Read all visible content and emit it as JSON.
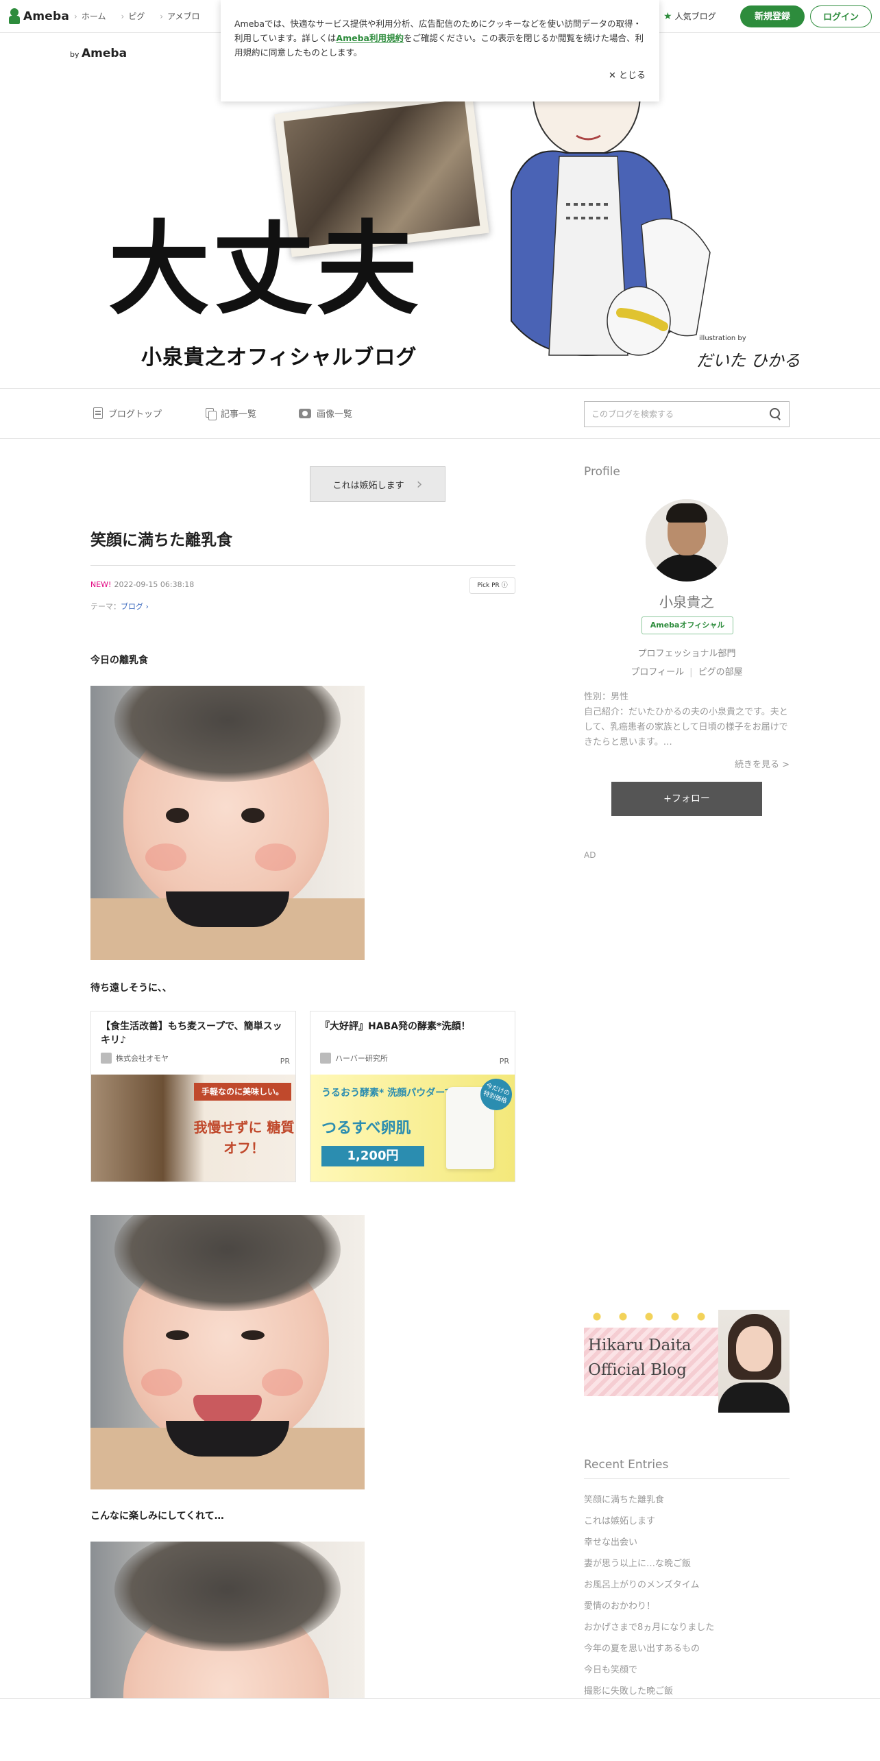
{
  "topbar": {
    "logo": "Ameba",
    "nav": [
      "ホーム",
      "ピグ",
      "アメブロ"
    ],
    "popular": "人気ブログ",
    "register": "新規登録",
    "login": "ログイン"
  },
  "cookie": {
    "text_before": "Amebaでは、快適なサービス提供や利用分析、広告配信のためにクッキーなどを使い訪問データの取得・利用しています。詳しくは",
    "link": "Ameba利用規約",
    "text_after": "をご確認ください。この表示を閉じるか閲覧を続けた場合、利用規約に同意したものとします。",
    "close": "とじる"
  },
  "header": {
    "by": "by",
    "by_brand": "Ameba",
    "title": "大丈夫",
    "subtitle": "小泉貴之オフィシャルブログ",
    "illustration_by": "illustration by",
    "illustrator": "だいた ひかる"
  },
  "blognav": {
    "top": "ブログトップ",
    "entries": "記事一覧",
    "images": "画像一覧",
    "search_placeholder": "このブログを検索する"
  },
  "post": {
    "reblog": "これは嫉妬します",
    "title": "笑顔に満ちた離乳食",
    "new_badge": "NEW!",
    "date": "2022-09-15 06:38:18",
    "pickpr": "Pick PR ⓘ",
    "theme_label": "テーマ：",
    "theme": "ブログ",
    "para1": "今日の離乳食",
    "para2": "待ち遠しそうに、、",
    "para3": "こんなに楽しみにしてくれて…"
  },
  "ads": [
    {
      "title": "【食生活改善】もち麦スープで、簡単スッキリ♪",
      "sponsor": "株式会社オモヤ",
      "pr": "PR",
      "banner": "手軽なのに美味しい。",
      "copy": "我慢せずに 糖質オフ！"
    },
    {
      "title": "『大好評』HABA発の酵素*洗顔！",
      "sponsor": "ハーバー研究所",
      "pr": "PR",
      "copy1": "うるおう酵素* 洗顔パウダーで",
      "copy2": "つるすべ卵肌",
      "price": "1,200円",
      "badge": "今だけの 特別価格"
    }
  ],
  "profile": {
    "heading": "Profile",
    "name": "小泉貴之",
    "official": "Amebaオフィシャル",
    "category": "プロフェッショナル部門",
    "link1": "プロフィール",
    "link2": "ピグの部屋",
    "bio": "性別：男性\n自己紹介：だいたひかるの夫の小泉貴之です。夫として、乳癌患者の家族として日頃の様子をお届けできたらと思います。…",
    "more": "続きを見る >",
    "follow": "+フォロー",
    "ad": "AD"
  },
  "hikaru": {
    "line1": "Hikaru Daita",
    "line2": "Official Blog"
  },
  "recent": {
    "heading": "Recent Entries",
    "items": [
      "笑顔に満ちた離乳食",
      "これは嫉妬します",
      "幸せな出会い",
      "妻が思う以上に…な晩ご飯",
      "お風呂上がりのメンズタイム",
      "愛情のおかわり！",
      "おかげさまで8ヵ月になりました",
      "今年の夏を思い出すあるもの",
      "今日も笑顔で",
      "撮影に失敗した晩ご飯"
    ]
  },
  "colors": {
    "brand_green": "#2d8c3c",
    "new_pink": "#e2007f",
    "theme_link": "#3d6bbf"
  }
}
